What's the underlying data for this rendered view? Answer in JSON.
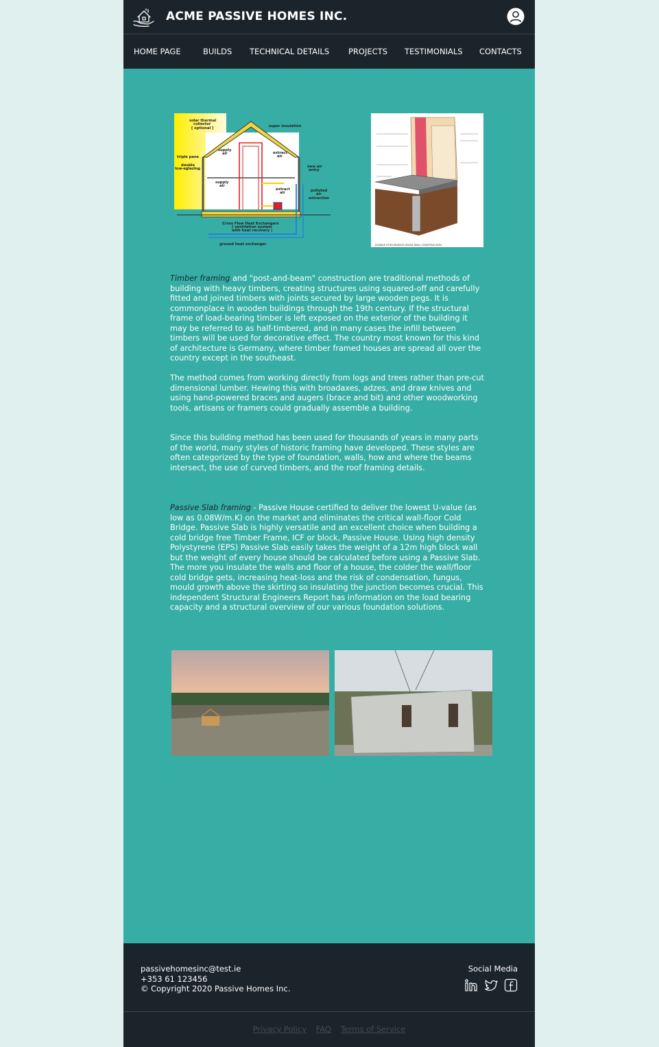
{
  "header": {
    "brand": "ACME PASSIVE HOMES INC.",
    "logo_icon": "house-hand-icon",
    "user_icon": "user-account-icon"
  },
  "nav": {
    "items": [
      {
        "label": "HOME PAGE"
      },
      {
        "label": "BUILDS"
      },
      {
        "label": "TECHNICAL DETAILS"
      },
      {
        "label": "PROJECTS"
      },
      {
        "label": "TESTIMONIALS"
      },
      {
        "label": "CONTACTS"
      }
    ]
  },
  "diagram": {
    "labels": {
      "solar": [
        "solar thermal",
        "collector",
        "[ optional ]"
      ],
      "super_insulation": "super insulation",
      "supply_air_top": [
        "supply",
        "air"
      ],
      "extract_air_top": [
        "extract",
        "air"
      ],
      "triple_pane": "triple pane",
      "double_glazing": [
        "double",
        "low-eglazing"
      ],
      "new_air_entry": [
        "new air",
        "entry"
      ],
      "supply_air_bottom": [
        "supply",
        "air"
      ],
      "extract_air_bottom": [
        "extract",
        "air"
      ],
      "polluted_air": [
        "polluted",
        "air",
        "extraction"
      ],
      "exchanger": [
        "Cross Flow Heat Exchangers",
        "( ventilation system",
        "with heat recovery )"
      ],
      "ground_heat": "ground heat exchanger"
    }
  },
  "wall_section": {
    "caption": "DOUBLE STUD PASSIVE HOUSE WALL CONSTRUCTION"
  },
  "articles": {
    "p1_em": "Timber framing",
    "p1": " and \"post-and-beam\" construction are traditional methods of building with heavy timbers, creating structures using squared-off and carefully fitted and joined timbers with joints secured by large wooden pegs. It is commonplace in wooden buildings through the 19th century. If the structural frame of load-bearing timber is left exposed on the exterior of the building it may be referred to as half-timbered, and in many cases the infill between timbers will be used for decorative effect. The country most known for this kind of architecture is Germany, where timber framed houses are spread all over the country except in the southeast.",
    "p2": "The method comes from working directly from logs and trees rather than pre-cut dimensional lumber. Hewing this with broadaxes, adzes, and draw knives and using hand-powered braces and augers (brace and bit) and other woodworking tools, artisans or framers could gradually assemble a building.",
    "p3": "Since this building method has been used for thousands of years in many parts of the world, many styles of historic framing have developed. These styles are often categorized by the type of foundation, walls, how and where the beams intersect, the use of curved timbers, and the roof framing details.",
    "p4_em": "Passive Slab framing",
    "p4": " - Passive House certified to deliver the lowest U-value (as low as 0.08W/m.K) on the market and eliminates the critical wall-floor Cold Bridge. Passive Slab is highly versatile and an excellent choice when building a cold bridge free Timber Frame, ICF or block, Passive House. Using high density Polystyrene (EPS) Passive Slab easily takes the weight of a 12m high block wall but the weight of every house should be calculated before using a Passive Slab. The more you insulate the walls and floor of a house, the colder the wall/floor cold bridge gets, increasing heat-loss and the risk of condensation, fungus, mould growth above the skirting so insulating the junction becomes crucial. This independent Structural Engineers Report has information on the load bearing capacity and a structural overview of our various foundation solutions."
  },
  "footer": {
    "email": "passivehomesinc@test.ie",
    "phone": "+353 61 123456",
    "copyright": "© Copyright 2020 Passive Homes Inc.",
    "social_title": "Social Media",
    "social_icons": [
      "linkedin-icon",
      "twitter-icon",
      "facebook-icon"
    ],
    "links": [
      "Privacy Policy",
      "FAQ",
      "Terms of Service"
    ]
  }
}
